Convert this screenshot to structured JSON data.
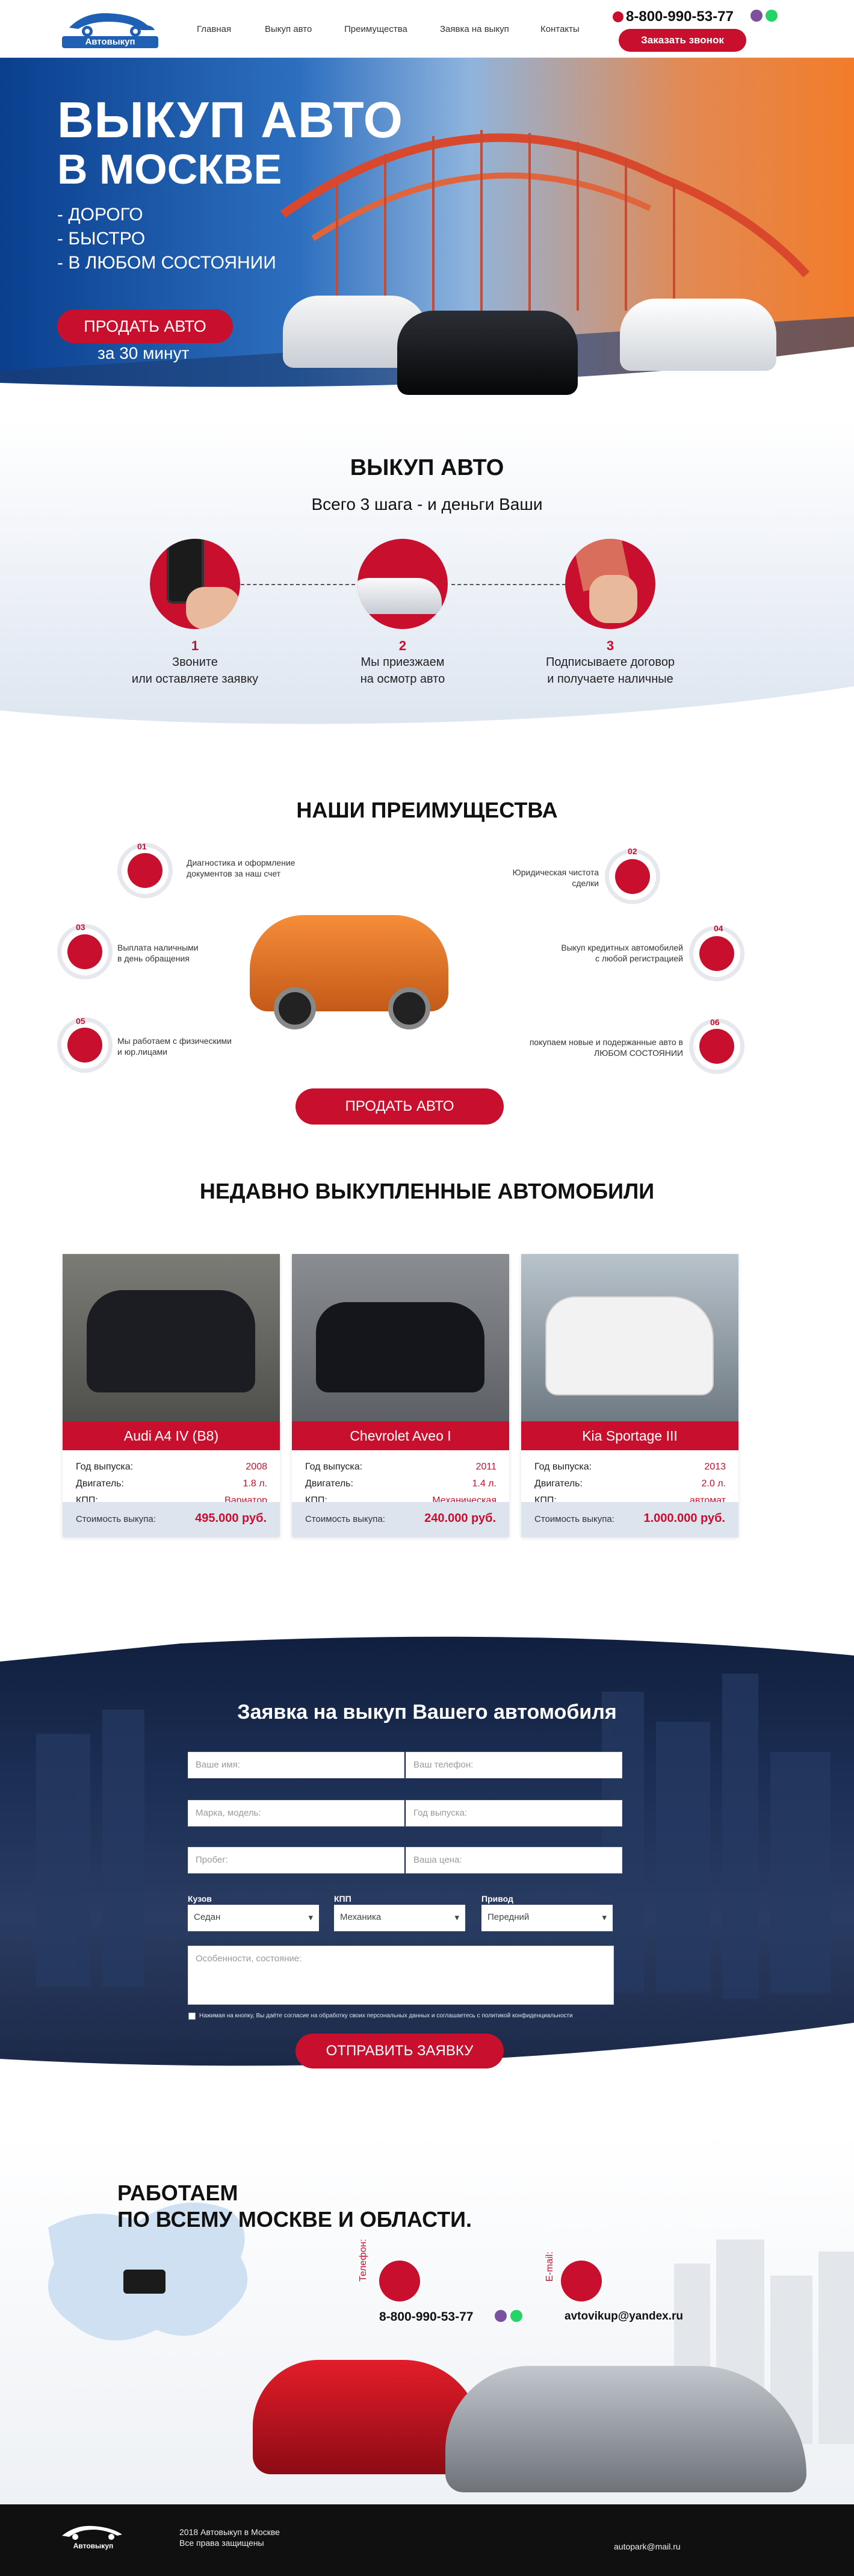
{
  "header": {
    "logo_text": "Автовыкуп",
    "nav": [
      "Главная",
      "Выкуп авто",
      "Преимущества",
      "Заявка на выкуп",
      "Контакты"
    ],
    "phone": "8-800-990-53-77",
    "call_button": "Заказать звонок"
  },
  "hero": {
    "title_line1": "ВЫКУП АВТО",
    "title_line2": "В МОСКВЕ",
    "bullets": [
      "- ДОРОГО",
      "- БЫСТРО",
      "- В ЛЮБОМ СОСТОЯНИИ"
    ],
    "sell_button": "ПРОДАТЬ АВТО",
    "sell_time": "за 30 минут"
  },
  "steps": {
    "title": "ВЫКУП АВТО",
    "subtitle": "Всего 3 шага - и деньги Ваши",
    "items": [
      {
        "num": "1",
        "line1": "Звоните",
        "line2": "или оставляете заявку"
      },
      {
        "num": "2",
        "line1": "Мы приезжаем",
        "line2": "на осмотр авто"
      },
      {
        "num": "3",
        "line1": "Подписываете договор",
        "line2": "и получаете наличные"
      }
    ]
  },
  "advantages": {
    "title": "НАШИ ПРЕИМУЩЕСТВА",
    "items": [
      {
        "num": "01",
        "line1": "Диагностика и оформление",
        "line2": "документов за наш счет"
      },
      {
        "num": "02",
        "line1": "Юридическая чистота",
        "line2": "сделки"
      },
      {
        "num": "03",
        "line1": "Выплата наличными",
        "line2": "в день обращения"
      },
      {
        "num": "04",
        "line1": "Выкуп кредитных автомобилей",
        "line2": "с любой регистрацией"
      },
      {
        "num": "05",
        "line1": "Мы работаем с физическими",
        "line2": "и юр.лицами"
      },
      {
        "num": "06",
        "line1": "покупаем новые и подержанные авто в",
        "line2": "ЛЮБОМ СОСТОЯНИИ"
      }
    ],
    "sell_button": "ПРОДАТЬ АВТО"
  },
  "recent": {
    "title": "НЕДАВНО ВЫКУПЛЕННЫЕ АВТОМОБИЛИ",
    "labels": {
      "year": "Год выпуска:",
      "engine": "Двигатель:",
      "gearbox": "КПП:",
      "price": "Стоимость выкупа:"
    },
    "cars": [
      {
        "name": "Audi A4 IV (B8)",
        "year": "2008",
        "engine": "1.8 л.",
        "gearbox": "Вариатор",
        "price": "495.000 руб.",
        "color": "#1b1d22"
      },
      {
        "name": "Chevrolet Aveo I",
        "year": "2011",
        "engine": "1.4 л.",
        "gearbox": "Механическая",
        "price": "240.000 руб.",
        "color": "#14161b"
      },
      {
        "name": "Kia Sportage III",
        "year": "2013",
        "engine": "2.0 л.",
        "gearbox": "автомат",
        "price": "1.000.000 руб.",
        "color": "#f2f2f2"
      }
    ]
  },
  "form": {
    "title": "Заявка на выкуп Вашего автомобиля",
    "fields": [
      {
        "placeholder": "Ваше имя:"
      },
      {
        "placeholder": "Ваш телефон:"
      },
      {
        "placeholder": "Марка, модель:"
      },
      {
        "placeholder": "Год выпуска:"
      },
      {
        "placeholder": "Пробег:"
      },
      {
        "placeholder": "Ваша цена:"
      }
    ],
    "selects": [
      {
        "label": "Кузов",
        "value": "Седан"
      },
      {
        "label": "КПП",
        "value": "Механика"
      },
      {
        "label": "Привод",
        "value": "Передний"
      }
    ],
    "textarea_placeholder": "Особенности, состояние:",
    "consent": "Нажимая на кнопку, Вы даёте согласие на обработку своих персональных данных и соглашаетесь с политикой конфиденциальности",
    "submit": "ОТПРАВИТЬ ЗАЯВКУ"
  },
  "contacts": {
    "title_line1": "РАБОТАЕМ",
    "title_line2": "ПО ВСЕМУ МОСКВЕ И ОБЛАСТИ.",
    "phone_label": "Телефон:",
    "phone": "8-800-990-53-77",
    "email_label": "E-mail:",
    "email": "avtovikup@yandex.ru"
  },
  "footer": {
    "logo_text": "Автовыкуп",
    "copyright_line1": "2018 Автовыкуп в Москве",
    "copyright_line2": "Все права защищены",
    "email": "autopark@mail.ru"
  },
  "colors": {
    "accent": "#c8102e",
    "dark": "#101010",
    "viber": "#7b519d",
    "whatsapp": "#25d366"
  }
}
